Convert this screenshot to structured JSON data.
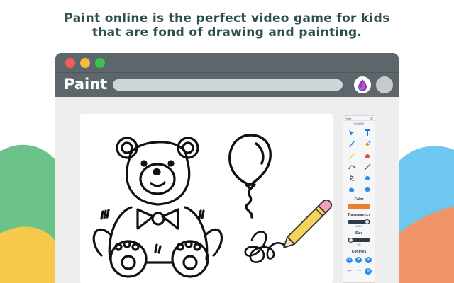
{
  "headline": {
    "line1": "Paint online is the perfect video game for kids",
    "line2": "that are fond of drawing and painting."
  },
  "window": {
    "app_title": "Paint",
    "controls": [
      "close-dot",
      "minimize-dot",
      "maximize-dot"
    ]
  },
  "panel": {
    "title": "Paint",
    "subtitle": "SHAPES",
    "tools": [
      "pointer-icon",
      "text-icon",
      "brush-icon",
      "fill-icon",
      "pencil-icon",
      "eraser-icon",
      "curve-icon",
      "line-icon",
      "path-icon",
      "blob-icon",
      "shape-icon",
      "ellipse-icon"
    ],
    "color_label": "Color",
    "color_value": "#f07d2a",
    "transparency_label": "Transparency",
    "transparency_value": "100%",
    "transparency_fraction": 1.0,
    "size_label": "Size",
    "size_value": "5%",
    "size_fraction": 0.05,
    "controls_label": "Controls",
    "controls": [
      "delete-icon",
      "close-icon",
      "clear-icon"
    ],
    "nav": [
      "undo-arrow-icon",
      "redo-arrow-icon",
      "menu-icon"
    ]
  },
  "colors": {
    "chrome": "#5d676b",
    "accent_blue": "#2c8be5",
    "pencil_yellow": "#f6d45b",
    "pencil_pink": "#f4a0b8"
  }
}
